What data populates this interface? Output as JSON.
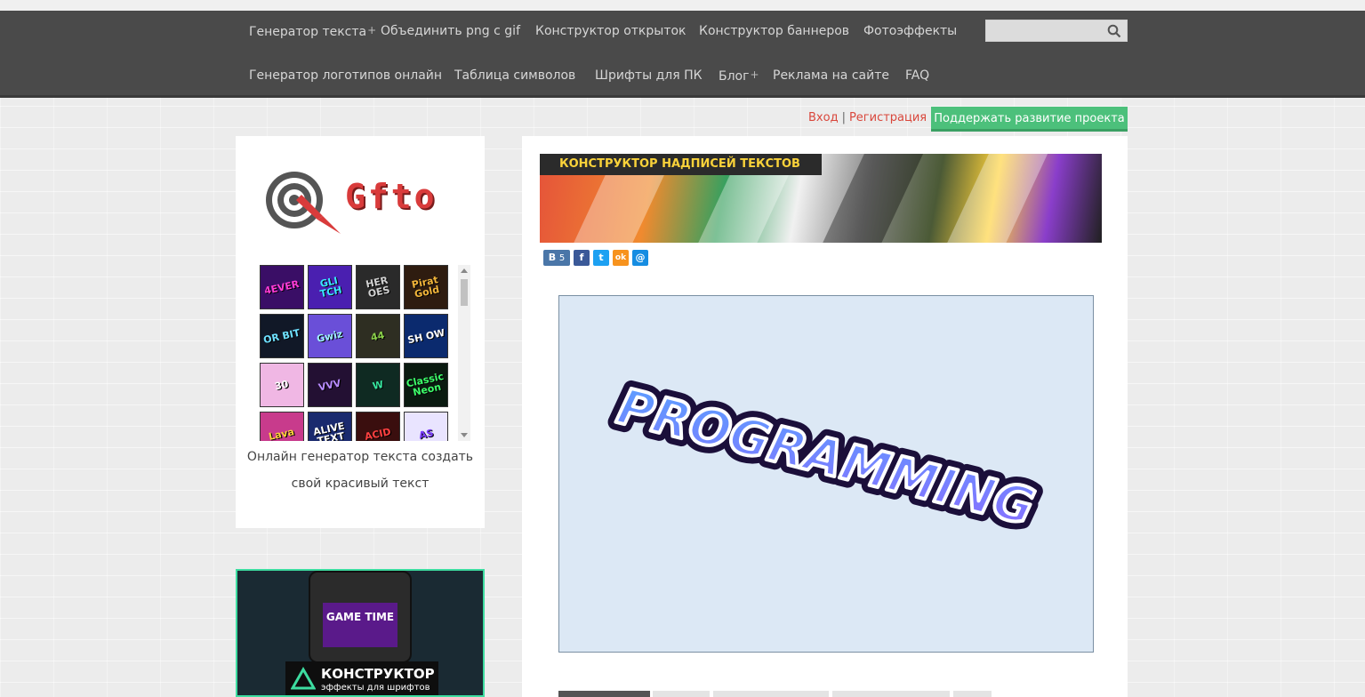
{
  "nav": {
    "row1": [
      {
        "label": "Генератор текста",
        "plus": "+"
      },
      {
        "label": "Объединить png с gif"
      },
      {
        "label": "Конструктор открыток"
      },
      {
        "label": "Конструктор баннеров"
      },
      {
        "label": "Фотоэффекты"
      }
    ],
    "row2": [
      {
        "label": "Генератор логотипов онлайн"
      },
      {
        "label": "Таблица символов"
      },
      {
        "label": "Шрифты для ПК"
      },
      {
        "label": "Блог",
        "plus": "+"
      },
      {
        "label": "Реклама на сайте"
      },
      {
        "label": "FAQ"
      }
    ],
    "search": {
      "value": "",
      "icon": "search-icon"
    }
  },
  "auth": {
    "login": "Вход",
    "separator": "|",
    "register": "Регистрация",
    "support_button": "Поддержать развитие проекта"
  },
  "sidebar": {
    "logo_text": "Gfto",
    "caption": "Онлайн генератор текста создать свой красивый текст",
    "thumbnails": [
      {
        "text": "4EVER",
        "bg": "#3a0e66",
        "fg": "#ff3cd6"
      },
      {
        "text": "GLI TCH",
        "bg": "#4a1fb0",
        "fg": "#39e6ff"
      },
      {
        "text": "HER OES",
        "bg": "#2a2a2a",
        "fg": "#d0d0d0"
      },
      {
        "text": "Pirat Gold",
        "bg": "#2e1c10",
        "fg": "#f2b53a"
      },
      {
        "text": "OR BIT",
        "bg": "#111827",
        "fg": "#6ee0ff"
      },
      {
        "text": "Gwiz",
        "bg": "#6a4fd8",
        "fg": "#9ff0ff"
      },
      {
        "text": "44",
        "bg": "#2e2e22",
        "fg": "#8bd14a"
      },
      {
        "text": "SH OW",
        "bg": "#0b2a6e",
        "fg": "#ffffff"
      },
      {
        "text": "30",
        "bg": "#f0b7e4",
        "fg": "#ffffff"
      },
      {
        "text": "VVV",
        "bg": "#231033",
        "fg": "#b88cff"
      },
      {
        "text": "W",
        "bg": "#0f2a22",
        "fg": "#37e6a0"
      },
      {
        "text": "Classic Neon",
        "bg": "#0a1a10",
        "fg": "#3dff6a"
      },
      {
        "text": "Lava",
        "bg": "#c83b8c",
        "fg": "#ffd23a"
      },
      {
        "text": "ALIVE TEXT",
        "bg": "#1a2a6e",
        "fg": "#ffffff"
      },
      {
        "text": "ACID",
        "bg": "#3a0e0e",
        "fg": "#ff4040"
      },
      {
        "text": "AS",
        "bg": "#e9e4ff",
        "fg": "#7a3cff"
      }
    ],
    "ad": {
      "screen_text": "GAME TIME",
      "title": "КОНСТРУКТОР",
      "subtitle": "эффекты для шрифтов"
    }
  },
  "main": {
    "banner_title": "КОНСТРУКТОР НАДПИСЕЙ ТЕКСТОВ",
    "share": [
      {
        "icon": "vk-icon",
        "label": "В",
        "count": "5",
        "color": "#4a76a8"
      },
      {
        "icon": "facebook-icon",
        "label": "f",
        "color": "#3b5998"
      },
      {
        "icon": "twitter-icon",
        "label": "t",
        "color": "#1da1f2"
      },
      {
        "icon": "odnoklassniki-icon",
        "label": "ok",
        "color": "#f7931e"
      },
      {
        "icon": "mail-icon",
        "label": "@",
        "color": "#168de2"
      }
    ],
    "canvas_text": "PROGRAMMING",
    "canvas_bg": "#dce8f5"
  },
  "colors": {
    "nav_bg": "#4a4a4a",
    "accent_green": "#4cc07b",
    "link_red": "#d9473c"
  }
}
